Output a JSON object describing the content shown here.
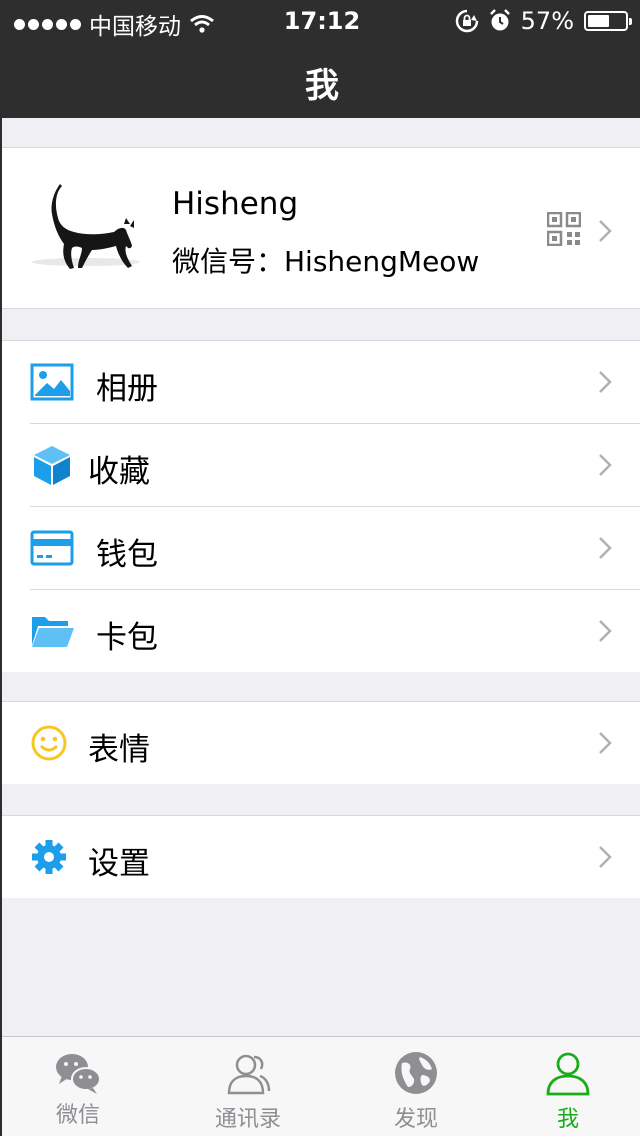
{
  "status_bar": {
    "carrier": "中国移动",
    "time": "17:12",
    "battery": "57%",
    "battery_level": 0.57
  },
  "nav": {
    "title": "我"
  },
  "profile": {
    "name": "Hisheng",
    "wechat_id": "微信号：HishengMeow"
  },
  "menu": {
    "album": "相册",
    "favorites": "收藏",
    "wallet": "钱包",
    "cards": "卡包",
    "stickers": "表情",
    "settings": "设置"
  },
  "tabs": [
    {
      "label": "微信",
      "icon": "chat-icon",
      "active": false
    },
    {
      "label": "通讯录",
      "icon": "contacts-icon",
      "active": false
    },
    {
      "label": "发现",
      "icon": "discover-icon",
      "active": false
    },
    {
      "label": "我",
      "icon": "me-icon",
      "active": true
    }
  ],
  "colors": {
    "header_bg": "#2E2E2E",
    "accent": "#1AAD19",
    "icon_blue": "#1C9EEB",
    "icon_yellow": "#F7C623"
  }
}
